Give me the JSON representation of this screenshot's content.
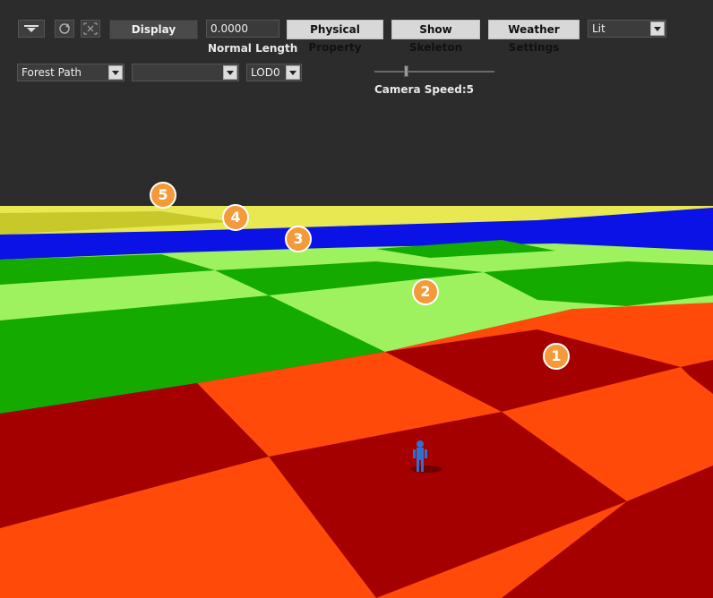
{
  "toolbar": {
    "display_label": "Display",
    "normal_length_value": "0.0000",
    "normal_length_label": "Normal Length",
    "physical_property_label": "Physical Property",
    "show_skeleton_label": "Show Skeleton",
    "weather_settings_label": "Weather Settings",
    "lighting_mode_value": "Lit",
    "scene_select_value": "Forest Path",
    "second_select_value": "",
    "lod_select_value": "LOD0",
    "camera_speed_label": "Camera Speed:5",
    "camera_speed_value": 5
  },
  "markers": [
    "1",
    "2",
    "3",
    "4",
    "5"
  ],
  "colors": {
    "panel_bg": "#2c2c2c",
    "red_light": "#ff4a0a",
    "red_dark": "#a50000",
    "green_light": "#9ef25f",
    "green_dark": "#14aa00",
    "blue": "#0a12e6",
    "yellow": "#e8e852",
    "marker_fill": "#f49a3a"
  },
  "icons": [
    "collapse-arrow-icon",
    "refresh-icon",
    "fit-view-icon",
    "character-figure"
  ]
}
